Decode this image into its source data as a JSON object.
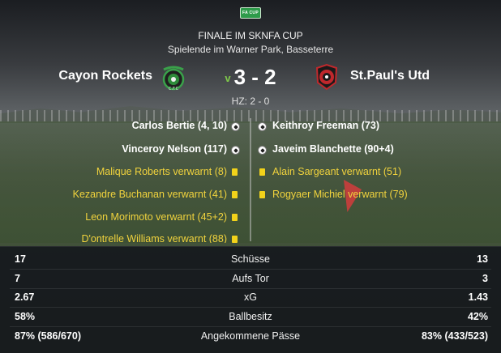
{
  "competition": {
    "logo_text": "FA CUP",
    "title": "FINALE IM SKNFA CUP",
    "venue": "Spielende im Warner Park, Basseterre"
  },
  "match": {
    "home_team": "Cayon Rockets",
    "away_team": "St.Paul's Utd",
    "winner_marker": "v",
    "score": "3 - 2",
    "half_time": "HZ: 2 - 0"
  },
  "events": {
    "home": [
      {
        "type": "goal",
        "text": "Carlos Bertie (4, 10)"
      },
      {
        "type": "goal",
        "text": "Vinceroy Nelson (117)"
      },
      {
        "type": "card",
        "text": "Malique Roberts verwarnt (8)"
      },
      {
        "type": "card",
        "text": "Kezandre Buchanan verwarnt (41)"
      },
      {
        "type": "card",
        "text": "Leon Morimoto verwarnt (45+2)"
      },
      {
        "type": "card",
        "text": "D'ontrelle Williams verwarnt (88)"
      }
    ],
    "away": [
      {
        "type": "goal",
        "text": "Keithroy Freeman (73)"
      },
      {
        "type": "goal",
        "text": "Javeim Blanchette (90+4)"
      },
      {
        "type": "card",
        "text": "Alain Sargeant verwarnt (51)"
      },
      {
        "type": "card",
        "text": "Rogyaer Michiel verwarnt (79)"
      }
    ]
  },
  "stats": [
    {
      "label": "Schüsse",
      "home": "17",
      "away": "13"
    },
    {
      "label": "Aufs Tor",
      "home": "7",
      "away": "3"
    },
    {
      "label": "xG",
      "home": "2.67",
      "away": "1.43"
    },
    {
      "label": "Ballbesitz",
      "home": "58%",
      "away": "42%"
    },
    {
      "label": "Angekommene Pässe",
      "home": "87% (586/670)",
      "away": "83% (433/523)"
    }
  ],
  "colors": {
    "winner_marker": "#7fc94a",
    "card_text": "#f1d33d",
    "home_crest": "#2e8b3a",
    "away_crest": "#c0282c"
  },
  "icons": {
    "goal": "ball-icon",
    "card": "yellow-card-icon"
  }
}
